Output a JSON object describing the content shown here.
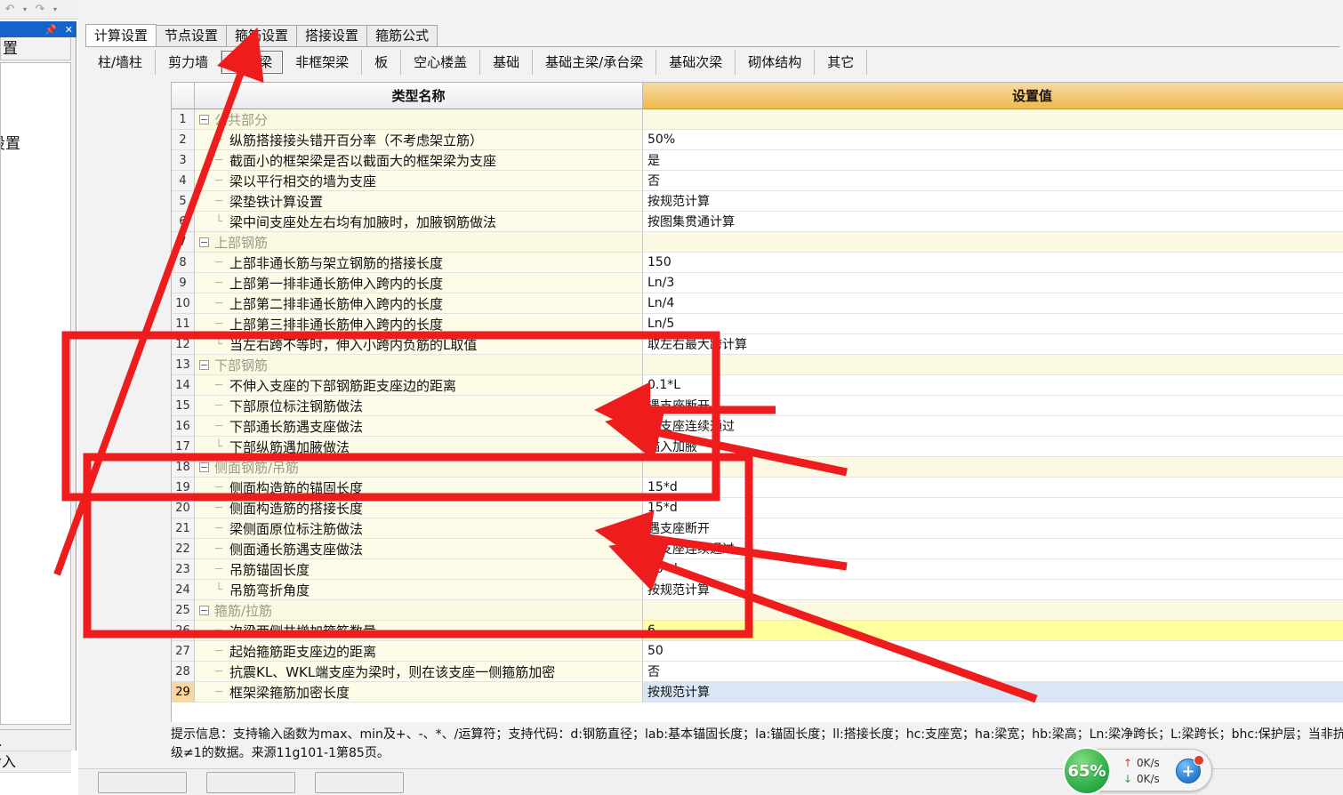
{
  "toolbar": {
    "undo_icon": "undo-icon",
    "undo_caret": "▾",
    "redo_icon": "redo-icon",
    "redo_caret": "▾"
  },
  "left_panel": {
    "pin_icon": "⊥",
    "close_icon": "✕",
    "tab_title": "置",
    "entry_label": "设置",
    "footer_items": [
      "入",
      "命入"
    ]
  },
  "tabs_primary": [
    {
      "label": "计算设置",
      "active": true
    },
    {
      "label": "节点设置",
      "active": false
    },
    {
      "label": "箍筋设置",
      "active": false
    },
    {
      "label": "搭接设置",
      "active": false
    },
    {
      "label": "箍筋公式",
      "active": false
    }
  ],
  "tabs_secondary": [
    {
      "label": "柱/墙柱",
      "active": false
    },
    {
      "label": "剪力墙",
      "active": false
    },
    {
      "label": "框架梁",
      "active": true
    },
    {
      "label": "非框架梁",
      "active": false
    },
    {
      "label": "板",
      "active": false
    },
    {
      "label": "空心楼盖",
      "active": false
    },
    {
      "label": "基础",
      "active": false
    },
    {
      "label": "基础主梁/承台梁",
      "active": false
    },
    {
      "label": "基础次梁",
      "active": false
    },
    {
      "label": "砌体结构",
      "active": false
    },
    {
      "label": "其它",
      "active": false
    }
  ],
  "grid": {
    "columns": {
      "row_number": "",
      "name": "类型名称",
      "value": "设置值"
    },
    "rows": [
      {
        "n": "1",
        "name": "公共部分",
        "value": "",
        "kind": "group"
      },
      {
        "n": "2",
        "name": "纵筋搭接接头错开百分率（不考虑架立筋）",
        "value": "50%",
        "kind": "item"
      },
      {
        "n": "3",
        "name": "截面小的框架梁是否以截面大的框架梁为支座",
        "value": "是",
        "kind": "item"
      },
      {
        "n": "4",
        "name": "梁以平行相交的墙为支座",
        "value": "否",
        "kind": "item"
      },
      {
        "n": "5",
        "name": "梁垫铁计算设置",
        "value": "按规范计算",
        "kind": "item"
      },
      {
        "n": "6",
        "name": "梁中间支座处左右均有加腋时，加腋钢筋做法",
        "value": "按图集贯通计算",
        "kind": "item-last"
      },
      {
        "n": "7",
        "name": "上部钢筋",
        "value": "",
        "kind": "group"
      },
      {
        "n": "8",
        "name": "上部非通长筋与架立钢筋的搭接长度",
        "value": "150",
        "kind": "item"
      },
      {
        "n": "9",
        "name": "上部第一排非通长筋伸入跨内的长度",
        "value": "Ln/3",
        "kind": "item"
      },
      {
        "n": "10",
        "name": "上部第二排非通长筋伸入跨内的长度",
        "value": "Ln/4",
        "kind": "item"
      },
      {
        "n": "11",
        "name": "上部第三排非通长筋伸入跨内的长度",
        "value": "Ln/5",
        "kind": "item"
      },
      {
        "n": "12",
        "name": "当左右跨不等时，伸入小跨内负筋的L取值",
        "value": "取左右最大跨计算",
        "kind": "item-last"
      },
      {
        "n": "13",
        "name": "下部钢筋",
        "value": "",
        "kind": "group"
      },
      {
        "n": "14",
        "name": "不伸入支座的下部钢筋距支座边的距离",
        "value": "0.1*L",
        "kind": "item"
      },
      {
        "n": "15",
        "name": "下部原位标注钢筋做法",
        "value": "遇支座断开",
        "kind": "item"
      },
      {
        "n": "16",
        "name": "下部通长筋遇支座做法",
        "value": "遇支座连续通过",
        "kind": "item"
      },
      {
        "n": "17",
        "name": "下部纵筋遇加腋做法",
        "value": "锚入加腋",
        "kind": "item-last"
      },
      {
        "n": "18",
        "name": "侧面钢筋/吊筋",
        "value": "",
        "kind": "group"
      },
      {
        "n": "19",
        "name": "侧面构造筋的锚固长度",
        "value": "15*d",
        "kind": "item"
      },
      {
        "n": "20",
        "name": "侧面构造筋的搭接长度",
        "value": "15*d",
        "kind": "item"
      },
      {
        "n": "21",
        "name": "梁侧面原位标注筋做法",
        "value": "遇支座断开",
        "kind": "item"
      },
      {
        "n": "22",
        "name": "侧面通长筋遇支座做法",
        "value": "遇支座连续通过",
        "kind": "item"
      },
      {
        "n": "23",
        "name": "吊筋锚固长度",
        "value": "20*d",
        "kind": "item"
      },
      {
        "n": "24",
        "name": "吊筋弯折角度",
        "value": "按规范计算",
        "kind": "item-last"
      },
      {
        "n": "25",
        "name": "箍筋/拉筋",
        "value": "",
        "kind": "group"
      },
      {
        "n": "26",
        "name": "次梁两侧共增加箍筋数量",
        "value": "6",
        "kind": "item",
        "value_highlight": "yellow"
      },
      {
        "n": "27",
        "name": "起始箍筋距支座边的距离",
        "value": "50",
        "kind": "item"
      },
      {
        "n": "28",
        "name": "抗震KL、WKL端支座为梁时，则在该支座一侧箍筋加密",
        "value": "否",
        "kind": "item"
      },
      {
        "n": "29",
        "name": "框架梁箍筋加密长度",
        "value": "按规范计算",
        "kind": "item",
        "value_highlight": "blue",
        "row_selected": true
      }
    ]
  },
  "hint": {
    "line1": "提示信息：支持输入函数为max、min及+、-、*、/运算符；支持代码：d:钢筋直径；lab:基本锚固长度；la:锚固长度；ll:搭接长度；hc:支座宽；ha:梁宽；hb:梁高；Ln:梁净跨长；L:梁跨长；bhc:保护层；当非抗",
    "line2": "级≠1的数据。来源11g101-1第85页。"
  },
  "bottom_buttons": [
    {
      "label": ""
    },
    {
      "label": ""
    },
    {
      "label": ""
    }
  ],
  "net_widget": {
    "percent": "65%",
    "upload_icon": "↑",
    "upload_rate": "0K/s",
    "download_icon": "↓",
    "download_rate": "0K/s",
    "add_icon": "+"
  },
  "colors": {
    "accent_orange": "#f0b94e",
    "group_text": "#9a9a8a",
    "panel_blue": "#1563c8",
    "annotation_red": "#ee1c1c",
    "highlight_yellow": "#ffff9e",
    "highlight_blue": "#d8e6f5",
    "selected_row_num": "#fbd6a0"
  }
}
